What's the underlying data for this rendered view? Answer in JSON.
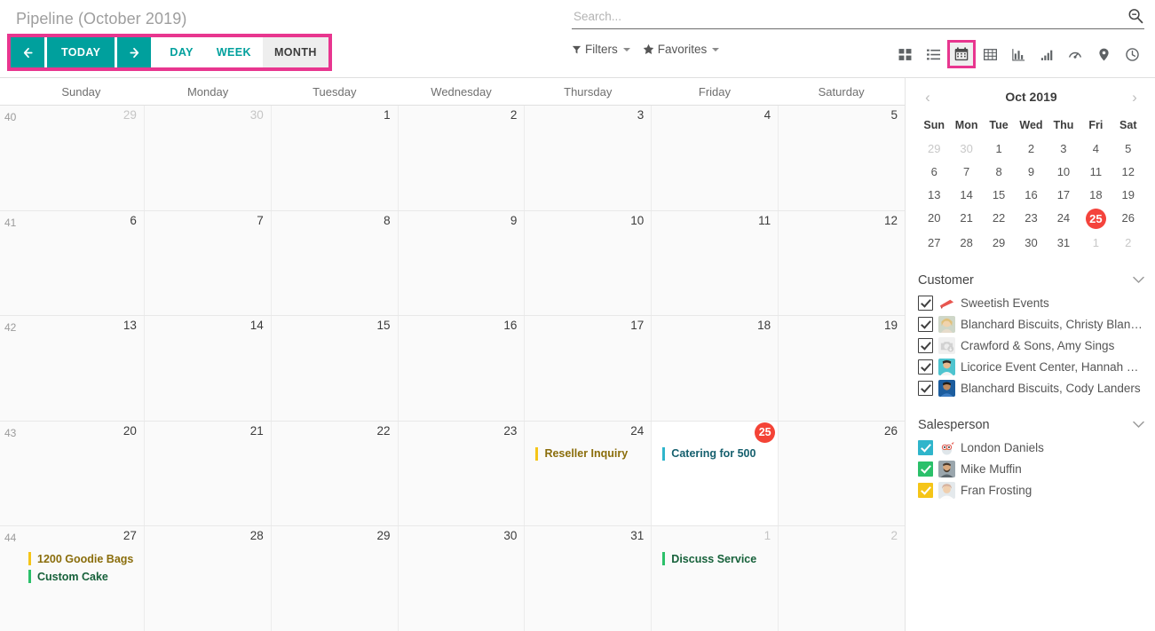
{
  "header": {
    "title": "Pipeline (October 2019)",
    "nav": {
      "prev_label": "←",
      "today_label": "TODAY",
      "next_label": "→"
    },
    "scales": [
      {
        "label": "DAY",
        "active": false
      },
      {
        "label": "WEEK",
        "active": false
      },
      {
        "label": "MONTH",
        "active": true
      }
    ],
    "search": {
      "placeholder": "Search...",
      "value": ""
    },
    "filters_label": "Filters",
    "favorites_label": "Favorites",
    "views": [
      {
        "name": "kanban-view",
        "label": "Kanban",
        "active": false
      },
      {
        "name": "list-view",
        "label": "List",
        "active": false
      },
      {
        "name": "calendar-view",
        "label": "Calendar",
        "active": true
      },
      {
        "name": "pivot-view",
        "label": "Pivot",
        "active": false
      },
      {
        "name": "graph-view",
        "label": "Graph",
        "active": false
      },
      {
        "name": "cohort-view",
        "label": "Cohort",
        "active": false
      },
      {
        "name": "dashboard-view",
        "label": "Dashboard",
        "active": false
      },
      {
        "name": "map-view",
        "label": "Map",
        "active": false
      },
      {
        "name": "activity-view",
        "label": "Activity",
        "active": false
      }
    ]
  },
  "calendar": {
    "day_names": [
      "Sunday",
      "Monday",
      "Tuesday",
      "Wednesday",
      "Thursday",
      "Friday",
      "Saturday"
    ],
    "weeks": [
      {
        "week_number": "40",
        "days": [
          {
            "num": "29",
            "other": true,
            "today": false,
            "events": []
          },
          {
            "num": "30",
            "other": true,
            "today": false,
            "events": []
          },
          {
            "num": "1",
            "other": false,
            "today": false,
            "events": []
          },
          {
            "num": "2",
            "other": false,
            "today": false,
            "events": []
          },
          {
            "num": "3",
            "other": false,
            "today": false,
            "events": []
          },
          {
            "num": "4",
            "other": false,
            "today": false,
            "events": []
          },
          {
            "num": "5",
            "other": false,
            "today": false,
            "events": []
          }
        ]
      },
      {
        "week_number": "41",
        "days": [
          {
            "num": "6",
            "other": false,
            "today": false,
            "events": []
          },
          {
            "num": "7",
            "other": false,
            "today": false,
            "events": []
          },
          {
            "num": "8",
            "other": false,
            "today": false,
            "events": []
          },
          {
            "num": "9",
            "other": false,
            "today": false,
            "events": []
          },
          {
            "num": "10",
            "other": false,
            "today": false,
            "events": []
          },
          {
            "num": "11",
            "other": false,
            "today": false,
            "events": []
          },
          {
            "num": "12",
            "other": false,
            "today": false,
            "events": []
          }
        ]
      },
      {
        "week_number": "42",
        "days": [
          {
            "num": "13",
            "other": false,
            "today": false,
            "events": []
          },
          {
            "num": "14",
            "other": false,
            "today": false,
            "events": []
          },
          {
            "num": "15",
            "other": false,
            "today": false,
            "events": []
          },
          {
            "num": "16",
            "other": false,
            "today": false,
            "events": []
          },
          {
            "num": "17",
            "other": false,
            "today": false,
            "events": []
          },
          {
            "num": "18",
            "other": false,
            "today": false,
            "events": []
          },
          {
            "num": "19",
            "other": false,
            "today": false,
            "events": []
          }
        ]
      },
      {
        "week_number": "43",
        "days": [
          {
            "num": "20",
            "other": false,
            "today": false,
            "events": []
          },
          {
            "num": "21",
            "other": false,
            "today": false,
            "events": []
          },
          {
            "num": "22",
            "other": false,
            "today": false,
            "events": []
          },
          {
            "num": "23",
            "other": false,
            "today": false,
            "events": []
          },
          {
            "num": "24",
            "other": false,
            "today": false,
            "events": [
              {
                "title": "Reseller Inquiry",
                "bar_color": "#f5c518",
                "text_color": "#8a6d0b"
              }
            ]
          },
          {
            "num": "25",
            "other": false,
            "today": true,
            "events": [
              {
                "title": "Catering for 500",
                "bar_color": "#2fb5cb",
                "text_color": "#16606e"
              }
            ]
          },
          {
            "num": "26",
            "other": false,
            "today": false,
            "events": []
          }
        ]
      },
      {
        "week_number": "44",
        "days": [
          {
            "num": "27",
            "other": false,
            "today": false,
            "events": [
              {
                "title": "1200 Goodie Bags",
                "bar_color": "#f5c518",
                "text_color": "#8a6d0b"
              },
              {
                "title": "Custom Cake",
                "bar_color": "#2bc06a",
                "text_color": "#16613a"
              }
            ]
          },
          {
            "num": "28",
            "other": false,
            "today": false,
            "events": []
          },
          {
            "num": "29",
            "other": false,
            "today": false,
            "events": []
          },
          {
            "num": "30",
            "other": false,
            "today": false,
            "events": []
          },
          {
            "num": "31",
            "other": false,
            "today": false,
            "events": []
          },
          {
            "num": "1",
            "other": true,
            "today": false,
            "events": [
              {
                "title": "Discuss Service",
                "bar_color": "#2bc06a",
                "text_color": "#16613a"
              }
            ]
          },
          {
            "num": "2",
            "other": true,
            "today": false,
            "events": []
          }
        ]
      }
    ]
  },
  "side_panel": {
    "mini_calendar": {
      "title": "Oct 2019",
      "prev_label": "‹",
      "next_label": "›",
      "day_initials": [
        "Sun",
        "Mon",
        "Tue",
        "Wed",
        "Thu",
        "Fri",
        "Sat"
      ],
      "today_color": "#f4433c",
      "days": [
        {
          "num": "29",
          "muted": true
        },
        {
          "num": "30",
          "muted": true
        },
        {
          "num": "1",
          "muted": false
        },
        {
          "num": "2",
          "muted": false
        },
        {
          "num": "3",
          "muted": false
        },
        {
          "num": "4",
          "muted": false
        },
        {
          "num": "5",
          "muted": false
        },
        {
          "num": "6",
          "muted": false
        },
        {
          "num": "7",
          "muted": false
        },
        {
          "num": "8",
          "muted": false
        },
        {
          "num": "9",
          "muted": false
        },
        {
          "num": "10",
          "muted": false
        },
        {
          "num": "11",
          "muted": false
        },
        {
          "num": "12",
          "muted": false
        },
        {
          "num": "13",
          "muted": false
        },
        {
          "num": "14",
          "muted": false
        },
        {
          "num": "15",
          "muted": false
        },
        {
          "num": "16",
          "muted": false
        },
        {
          "num": "17",
          "muted": false
        },
        {
          "num": "18",
          "muted": false
        },
        {
          "num": "19",
          "muted": false
        },
        {
          "num": "20",
          "muted": false
        },
        {
          "num": "21",
          "muted": false
        },
        {
          "num": "22",
          "muted": false
        },
        {
          "num": "23",
          "muted": false
        },
        {
          "num": "24",
          "muted": false
        },
        {
          "num": "25",
          "muted": false,
          "today": true
        },
        {
          "num": "26",
          "muted": false
        },
        {
          "num": "27",
          "muted": false
        },
        {
          "num": "28",
          "muted": false
        },
        {
          "num": "29",
          "muted": false
        },
        {
          "num": "30",
          "muted": false
        },
        {
          "num": "31",
          "muted": false
        },
        {
          "num": "1",
          "muted": true
        },
        {
          "num": "2",
          "muted": true
        }
      ]
    },
    "sections": [
      {
        "title": "Customer",
        "items": [
          {
            "label": "Sweetish Events",
            "checked": true,
            "checkbox_color": "",
            "avatar": "cake-logo"
          },
          {
            "label": "Blanchard Biscuits, Christy Blanc…",
            "checked": true,
            "checkbox_color": "",
            "avatar": "woman-blonde"
          },
          {
            "label": "Crawford & Sons, Amy Sings",
            "checked": true,
            "checkbox_color": "",
            "avatar": "no-photo"
          },
          {
            "label": "Licorice Event Center, Hannah Wa…",
            "checked": true,
            "checkbox_color": "",
            "avatar": "man-teal"
          },
          {
            "label": "Blanchard Biscuits, Cody Landers",
            "checked": true,
            "checkbox_color": "",
            "avatar": "man-blue"
          }
        ]
      },
      {
        "title": "Salesperson",
        "items": [
          {
            "label": "London Daniels",
            "checked": true,
            "checkbox_color": "#2fb5cb",
            "avatar": "owl-avatar"
          },
          {
            "label": "Mike Muffin",
            "checked": true,
            "checkbox_color": "#2bc06a",
            "avatar": "man-beard"
          },
          {
            "label": "Fran Frosting",
            "checked": true,
            "checkbox_color": "#f5c518",
            "avatar": "woman-chef"
          }
        ]
      }
    ]
  }
}
